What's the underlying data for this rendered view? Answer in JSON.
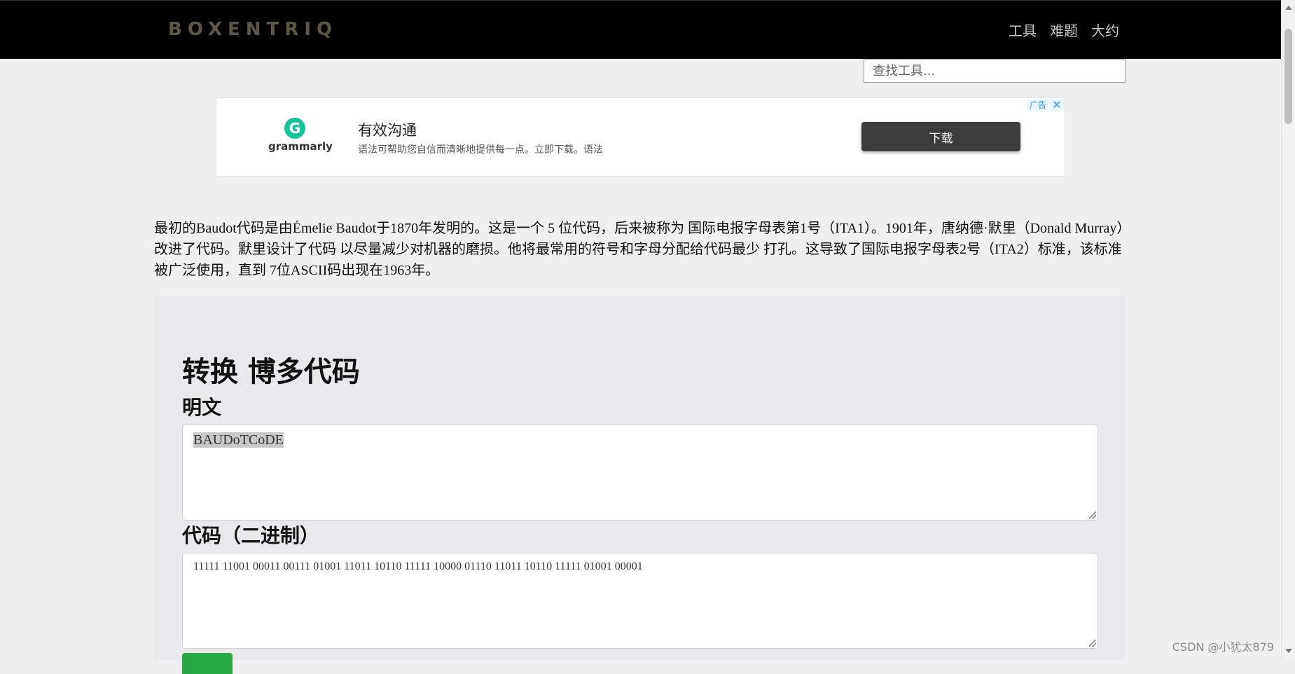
{
  "navbar": {
    "brand": "BOXENTRIQ",
    "links": [
      "工具",
      "难题",
      "大约"
    ],
    "search_placeholder": "查找工具..."
  },
  "ad": {
    "logo_letter": "G",
    "logo_text": "grammarly",
    "title": "有效沟通",
    "description": "语法可帮助您自信而清晰地提供每一点。立即下载。语法",
    "button_label": "下载",
    "badge": "广告",
    "close_icon": "close-icon"
  },
  "intro": {
    "text": "最初的Baudot代码是由Émelie Baudot于1870年发明的。这是一个 5 位代码，后来被称为 国际电报字母表第1号（ITA1）。1901年，唐纳德·默里（Donald Murray）改进了代码。默里设计了代码 以尽量减少对机器的磨损。他将最常用的符号和字母分配给代码最少 打孔。这导致了国际电报字母表2号（ITA2）标准，该标准被广泛使用，直到 7位ASCII码出现在1963年。"
  },
  "converter": {
    "title": "转换 博多代码",
    "plaintext_label": "明文",
    "plaintext_value": "BAUDoTCoDE",
    "code_label": "代码（二进制）",
    "code_value": "11111 11001 00011 00111 01001 11011 10110 11111 10000 01110 11011 10110 11111 01001 00001"
  },
  "watermark": "CSDN @小犹太879"
}
